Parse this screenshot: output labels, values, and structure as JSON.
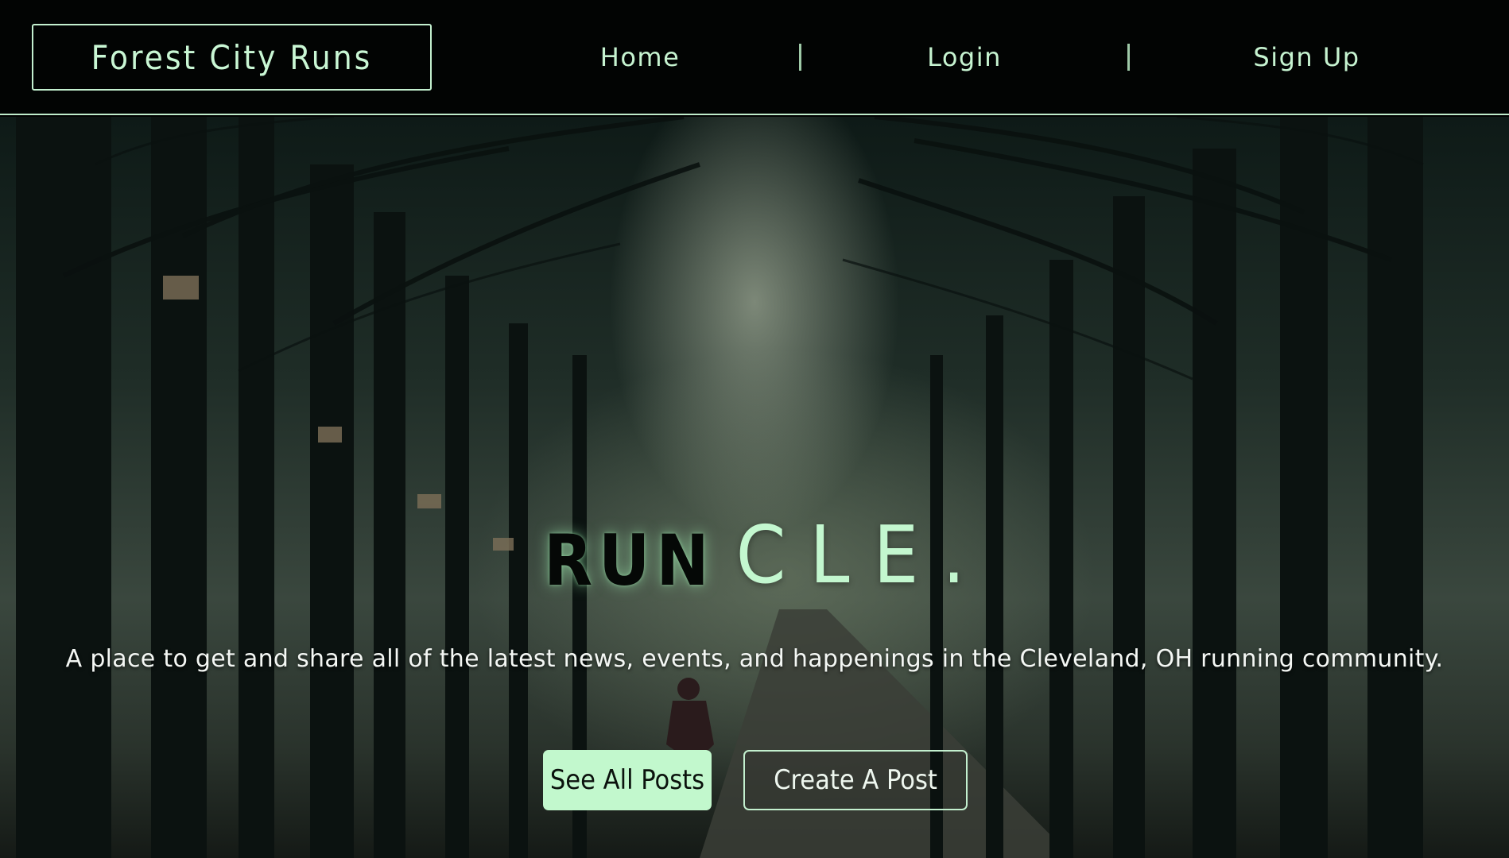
{
  "brand": {
    "title": "Forest City Runs"
  },
  "nav": {
    "home": "Home",
    "login": "Login",
    "signup": "Sign Up"
  },
  "hero": {
    "title_run": "RUN",
    "title_cle": "CLE.",
    "subtitle": "A place to get and share all of the latest news, events, and happenings in the Cleveland, OH running community.",
    "btn_all_posts": "See All Posts",
    "btn_create_post": "Create A Post"
  },
  "colors": {
    "accent": "#c2f8cd",
    "header_bg": "#020403",
    "header_border": "#bfeccb"
  }
}
